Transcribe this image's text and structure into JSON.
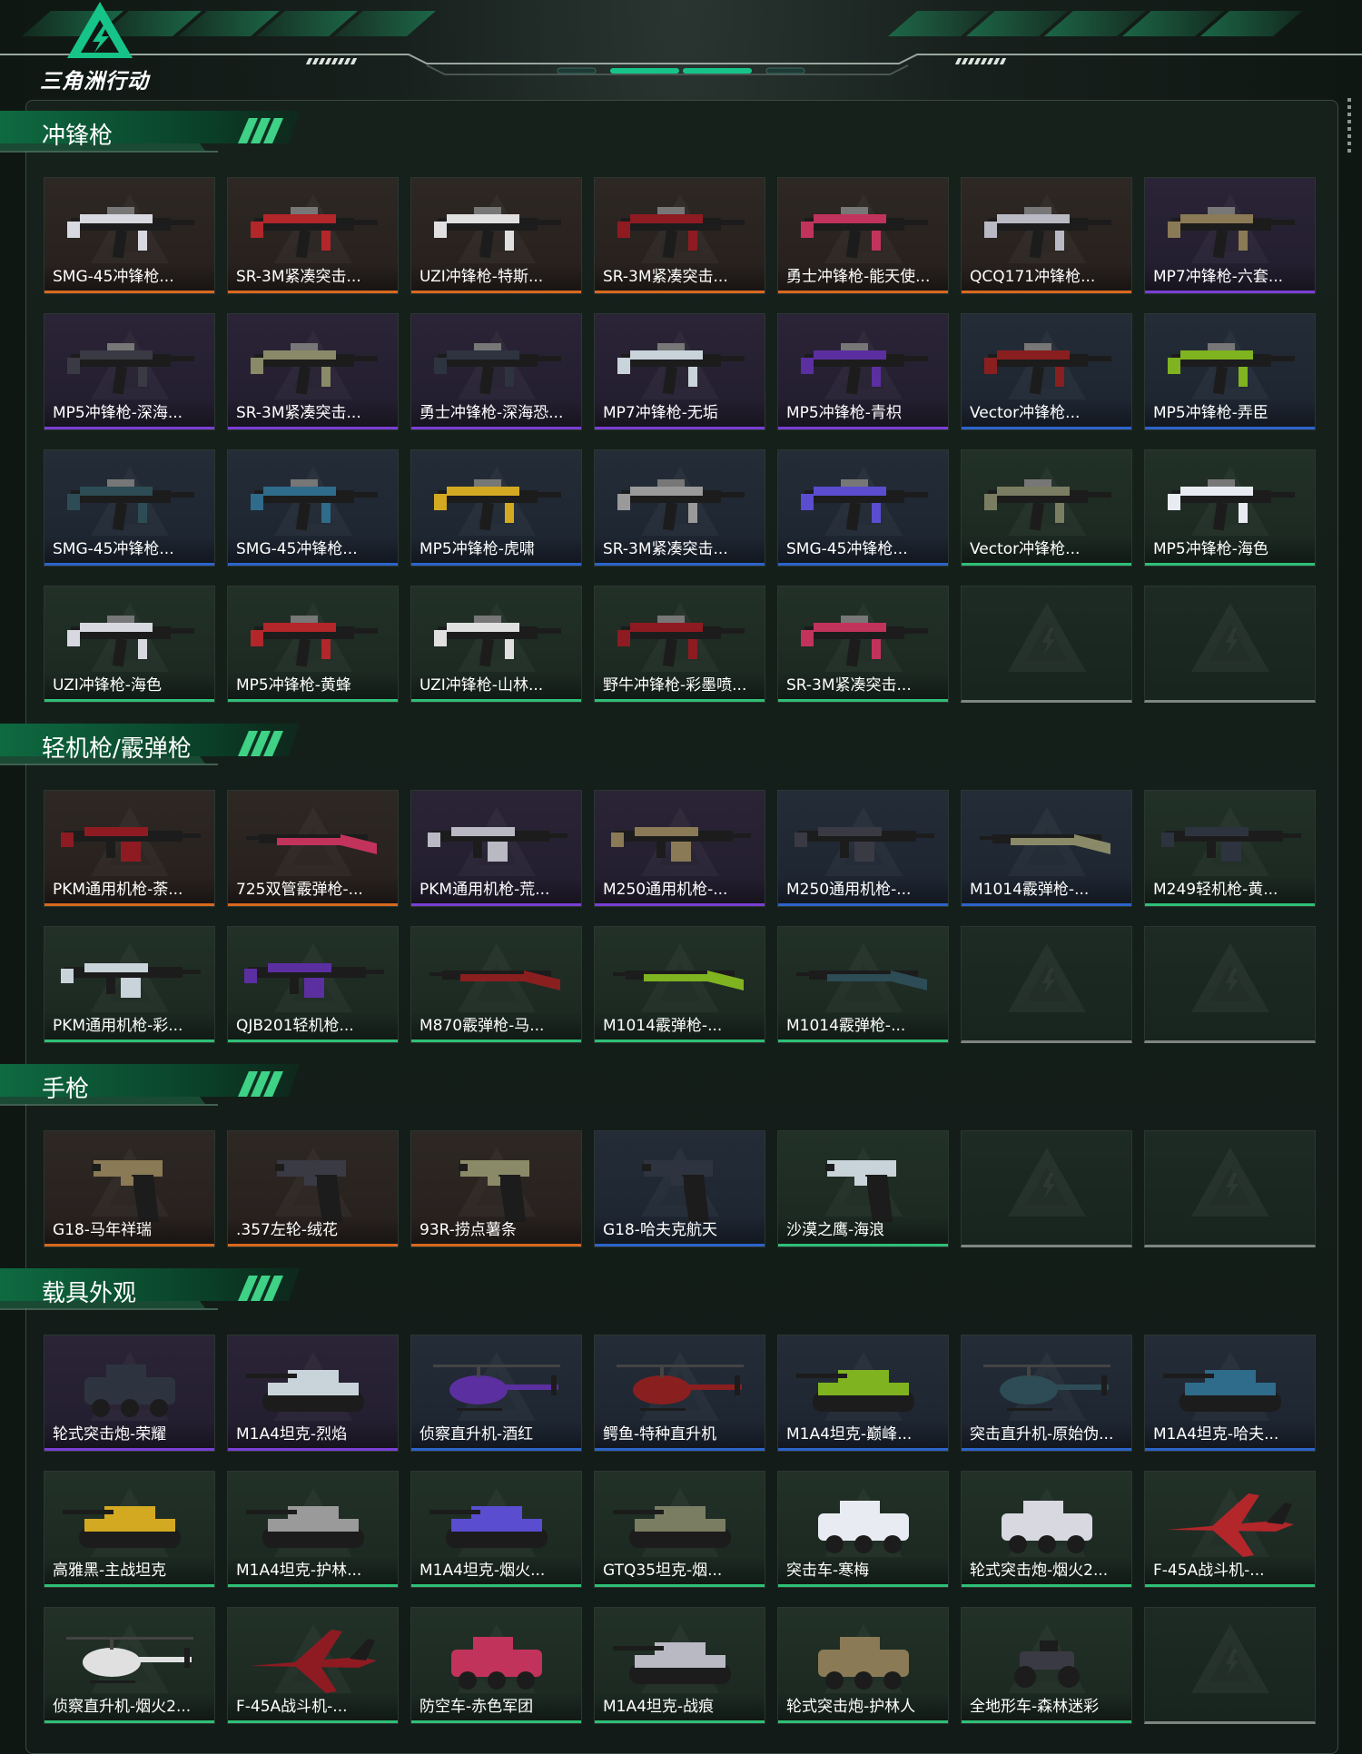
{
  "brand": {
    "logo_text": "三角洲行动",
    "colors": {
      "accent": "#17c48a",
      "header_stripe": "#1c6e4b"
    }
  },
  "rarity_colors": {
    "orange": "#d8691e",
    "purple": "#7a3fd4",
    "blue": "#2c64c9",
    "green": "#2fbf77",
    "gray": "#7f8682"
  },
  "sections": [
    {
      "title": "冲锋枪",
      "items": [
        {
          "label": "SMG-45冲锋枪...",
          "rarity": "orange",
          "icon": "smg-icon"
        },
        {
          "label": "SR-3M紧凑突击...",
          "rarity": "orange",
          "icon": "smg-icon"
        },
        {
          "label": "UZI冲锋枪-特斯...",
          "rarity": "orange",
          "icon": "smg-icon"
        },
        {
          "label": "SR-3M紧凑突击...",
          "rarity": "orange",
          "icon": "smg-icon"
        },
        {
          "label": "勇士冲锋枪-能天使...",
          "rarity": "orange",
          "icon": "smg-icon"
        },
        {
          "label": "QCQ171冲锋枪...",
          "rarity": "orange",
          "icon": "smg-icon"
        },
        {
          "label": "MP7冲锋枪-六套...",
          "rarity": "purple",
          "icon": "smg-icon"
        },
        {
          "label": "MP5冲锋枪-深海...",
          "rarity": "purple",
          "icon": "smg-icon"
        },
        {
          "label": "SR-3M紧凑突击...",
          "rarity": "purple",
          "icon": "smg-icon"
        },
        {
          "label": "勇士冲锋枪-深海恐...",
          "rarity": "purple",
          "icon": "smg-icon"
        },
        {
          "label": "MP7冲锋枪-无垢",
          "rarity": "purple",
          "icon": "smg-icon"
        },
        {
          "label": "MP5冲锋枪-青枳",
          "rarity": "purple",
          "icon": "smg-icon"
        },
        {
          "label": "Vector冲锋枪...",
          "rarity": "blue",
          "icon": "smg-icon"
        },
        {
          "label": "MP5冲锋枪-弄臣",
          "rarity": "blue",
          "icon": "smg-icon"
        },
        {
          "label": "SMG-45冲锋枪...",
          "rarity": "blue",
          "icon": "smg-icon"
        },
        {
          "label": "SMG-45冲锋枪...",
          "rarity": "blue",
          "icon": "smg-icon"
        },
        {
          "label": "MP5冲锋枪-虎啸",
          "rarity": "blue",
          "icon": "smg-icon"
        },
        {
          "label": "SR-3M紧凑突击...",
          "rarity": "blue",
          "icon": "smg-icon"
        },
        {
          "label": "SMG-45冲锋枪...",
          "rarity": "blue",
          "icon": "smg-icon"
        },
        {
          "label": "Vector冲锋枪...",
          "rarity": "green",
          "icon": "smg-icon"
        },
        {
          "label": "MP5冲锋枪-海色",
          "rarity": "green",
          "icon": "smg-icon"
        },
        {
          "label": "UZI冲锋枪-海色",
          "rarity": "green",
          "icon": "smg-icon"
        },
        {
          "label": "MP5冲锋枪-黄蜂",
          "rarity": "green",
          "icon": "smg-icon"
        },
        {
          "label": "UZI冲锋枪-山林...",
          "rarity": "green",
          "icon": "smg-icon"
        },
        {
          "label": "野牛冲锋枪-彩墨喷...",
          "rarity": "green",
          "icon": "smg-icon"
        },
        {
          "label": "SR-3M紧凑突击...",
          "rarity": "green",
          "icon": "smg-icon"
        }
      ],
      "empty_slots": 2
    },
    {
      "title": "轻机枪/霰弹枪",
      "items": [
        {
          "label": "PKM通用机枪-荼...",
          "rarity": "orange",
          "icon": "lmg-icon"
        },
        {
          "label": "725双管霰弹枪-...",
          "rarity": "orange",
          "icon": "shotgun-icon"
        },
        {
          "label": "PKM通用机枪-荒...",
          "rarity": "purple",
          "icon": "lmg-icon"
        },
        {
          "label": "M250通用机枪-...",
          "rarity": "purple",
          "icon": "lmg-icon"
        },
        {
          "label": "M250通用机枪-...",
          "rarity": "blue",
          "icon": "lmg-icon"
        },
        {
          "label": "M1014霰弹枪-...",
          "rarity": "blue",
          "icon": "shotgun-icon"
        },
        {
          "label": "M249轻机枪-黄...",
          "rarity": "green",
          "icon": "lmg-icon"
        },
        {
          "label": "PKM通用机枪-彩...",
          "rarity": "green",
          "icon": "lmg-icon"
        },
        {
          "label": "QJB201轻机枪...",
          "rarity": "green",
          "icon": "lmg-icon"
        },
        {
          "label": "M870霰弹枪-马...",
          "rarity": "green",
          "icon": "shotgun-icon"
        },
        {
          "label": "M1014霰弹枪-...",
          "rarity": "green",
          "icon": "shotgun-icon"
        },
        {
          "label": "M1014霰弹枪-...",
          "rarity": "green",
          "icon": "shotgun-icon"
        }
      ],
      "empty_slots": 2
    },
    {
      "title": "手枪",
      "items": [
        {
          "label": "G18-马年祥瑞",
          "rarity": "orange",
          "icon": "pistol-icon"
        },
        {
          "label": ".357左轮-绒花",
          "rarity": "orange",
          "icon": "pistol-icon"
        },
        {
          "label": "93R-捞点薯条",
          "rarity": "orange",
          "icon": "pistol-icon"
        },
        {
          "label": "G18-哈夫克航天",
          "rarity": "blue",
          "icon": "pistol-icon"
        },
        {
          "label": "沙漠之鹰-海浪",
          "rarity": "green",
          "icon": "pistol-icon"
        }
      ],
      "empty_slots": 2
    },
    {
      "title": "载具外观",
      "items": [
        {
          "label": "轮式突击炮-荣耀",
          "rarity": "purple",
          "icon": "armored-car-icon"
        },
        {
          "label": "M1A4坦克-烈焰",
          "rarity": "purple",
          "icon": "tank-icon"
        },
        {
          "label": "侦察直升机-酒红",
          "rarity": "blue",
          "icon": "helicopter-icon"
        },
        {
          "label": "鳄鱼-特种直升机",
          "rarity": "blue",
          "icon": "helicopter-icon"
        },
        {
          "label": "M1A4坦克-巅峰...",
          "rarity": "blue",
          "icon": "tank-icon"
        },
        {
          "label": "突击直升机-原始伪...",
          "rarity": "blue",
          "icon": "helicopter-icon"
        },
        {
          "label": "M1A4坦克-哈夫...",
          "rarity": "blue",
          "icon": "tank-icon"
        },
        {
          "label": "高雅黑-主战坦克",
          "rarity": "green",
          "icon": "tank-icon"
        },
        {
          "label": "M1A4坦克-护林...",
          "rarity": "green",
          "icon": "tank-icon"
        },
        {
          "label": "M1A4坦克-烟火...",
          "rarity": "green",
          "icon": "tank-icon"
        },
        {
          "label": "GTQ35坦克-烟...",
          "rarity": "green",
          "icon": "tank-icon"
        },
        {
          "label": "突击车-寒梅",
          "rarity": "green",
          "icon": "armored-car-icon"
        },
        {
          "label": "轮式突击炮-烟火2...",
          "rarity": "green",
          "icon": "armored-car-icon"
        },
        {
          "label": "F-45A战斗机-...",
          "rarity": "green",
          "icon": "jet-icon"
        },
        {
          "label": "侦察直升机-烟火2...",
          "rarity": "green",
          "icon": "helicopter-icon"
        },
        {
          "label": "F-45A战斗机-...",
          "rarity": "green",
          "icon": "jet-icon"
        },
        {
          "label": "防空车-赤色军团",
          "rarity": "green",
          "icon": "armored-car-icon"
        },
        {
          "label": "M1A4坦克-战痕",
          "rarity": "green",
          "icon": "tank-icon"
        },
        {
          "label": "轮式突击炮-护林人",
          "rarity": "green",
          "icon": "armored-car-icon"
        },
        {
          "label": "全地形车-森林迷彩",
          "rarity": "green",
          "icon": "atv-icon"
        }
      ],
      "empty_slots": 1
    }
  ]
}
